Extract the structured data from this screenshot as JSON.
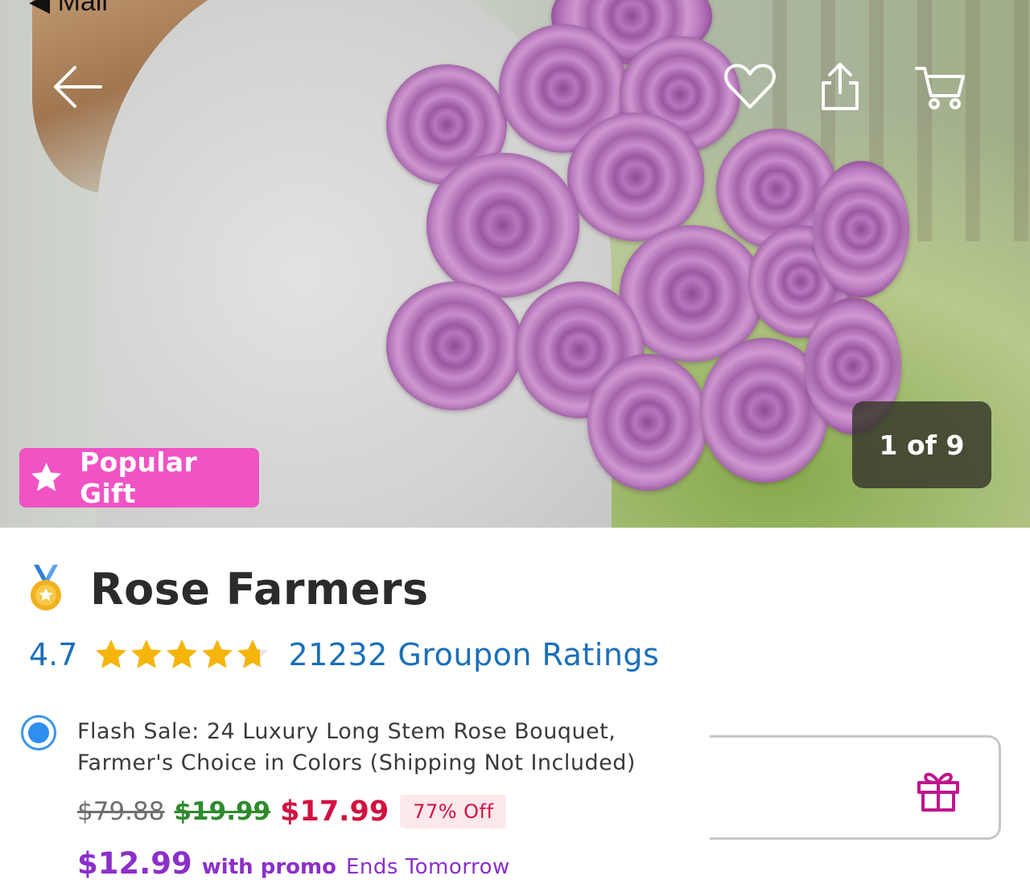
{
  "status_bar": {
    "back_app_label": "◀ Mail"
  },
  "header": {
    "back_icon": "arrow-left-icon",
    "favorite_icon": "heart-icon",
    "share_icon": "share-icon",
    "cart_icon": "cart-icon"
  },
  "gallery": {
    "badge_label": "Popular Gift",
    "badge_icon": "star-icon",
    "badge_color": "#f053c4",
    "counter": "1 of 9"
  },
  "merchant": {
    "name": "Rose Farmers",
    "medal_icon": "medal-icon"
  },
  "rating": {
    "value": "4.7",
    "stars": 4.7,
    "count_label": "21232 Groupon Ratings",
    "color": "#1b6fb8"
  },
  "option": {
    "selected": true,
    "title": "Flash Sale: 24 Luxury Long Stem Rose Bouquet, Farmer's Choice in Colors (Shipping Not Included)",
    "original_price": "$79.88",
    "previous_price": "$19.99",
    "sale_price": "$17.99",
    "discount": "77% Off",
    "promo_price": "$12.99",
    "promo_label": "with promo",
    "promo_ends": "Ends Tomorrow"
  },
  "gift": {
    "icon": "gift-icon",
    "color": "#c0148f"
  }
}
